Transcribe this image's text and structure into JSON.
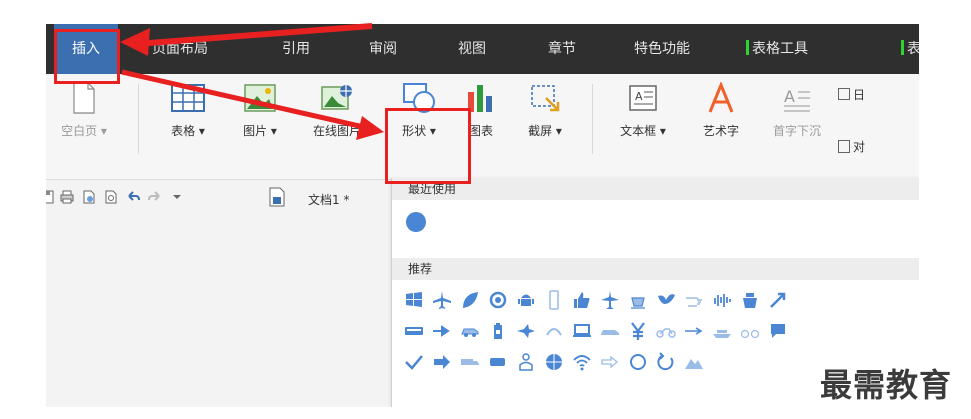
{
  "menubar": {
    "tabs": [
      {
        "label": "插入"
      },
      {
        "label": "页面布局"
      },
      {
        "label": "引用"
      },
      {
        "label": "审阅"
      },
      {
        "label": "视图"
      },
      {
        "label": "章节"
      },
      {
        "label": "特色功能"
      },
      {
        "label": "表格工具"
      },
      {
        "label": "表"
      }
    ]
  },
  "ribbon": {
    "blank_page": "空白页",
    "table": "表格",
    "picture": "图片",
    "online_picture": "在线图片",
    "shape": "形状",
    "chart": "图表",
    "screenshot": "截屏",
    "textbox": "文本框",
    "wordart": "艺术字",
    "dropcap": "首字下沉",
    "date": "日",
    "object": "对"
  },
  "quick_access": {
    "doc_tab": "文档1 *"
  },
  "dropdown": {
    "recent_header": "最近使用",
    "recommended_header": "推荐"
  },
  "colors": {
    "accent_blue": "#3c6fb0",
    "shape_blue": "#4a86d4",
    "annotation_red": "#e82020",
    "table_tool_green": "#2fd42f"
  },
  "watermark": "最需教育"
}
